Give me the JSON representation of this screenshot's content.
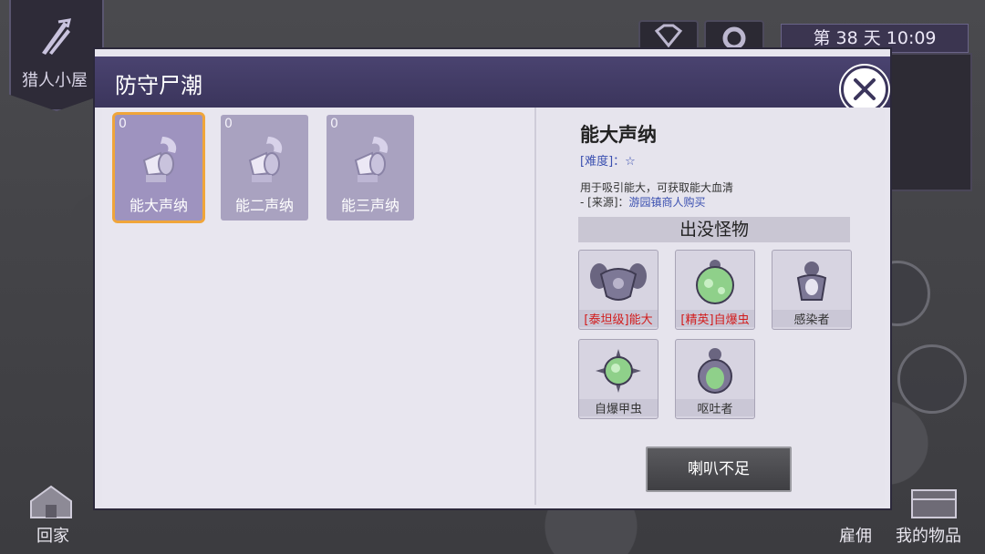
{
  "hud": {
    "hut_label": "猎人小屋",
    "day_text": "第 38 天",
    "time": "10:09",
    "home_label": "回家",
    "hire_label": "雇佣",
    "items_label": "我的物品"
  },
  "dialog": {
    "title": "防守尸潮",
    "slots": [
      {
        "count": "0",
        "name": "能大声纳",
        "selected": true
      },
      {
        "count": "0",
        "name": "能二声纳",
        "selected": false
      },
      {
        "count": "0",
        "name": "能三声纳",
        "selected": false
      }
    ],
    "detail": {
      "title": "能大声纳",
      "difficulty_label": "[难度]",
      "difficulty_sep": "：",
      "difficulty_stars": "☆",
      "description": "用于吸引能大，可获取能大血清",
      "source_prefix": "- [来源]：",
      "source": "游园镇商人购买",
      "monsters_header": "出没怪物",
      "monsters": [
        {
          "name": "[泰坦级]能大",
          "highlight": true
        },
        {
          "name": "[精英]自爆虫",
          "highlight": true
        },
        {
          "name": "感染者",
          "highlight": false
        },
        {
          "name": "自爆甲虫",
          "highlight": false
        },
        {
          "name": "呕吐者",
          "highlight": false
        }
      ],
      "action_label": "喇叭不足"
    }
  },
  "colors": {
    "header": "#3b355c",
    "selected_outline": "#f0a53a",
    "elite_text": "#d21c1c",
    "info_blue": "#3a4fb0"
  }
}
